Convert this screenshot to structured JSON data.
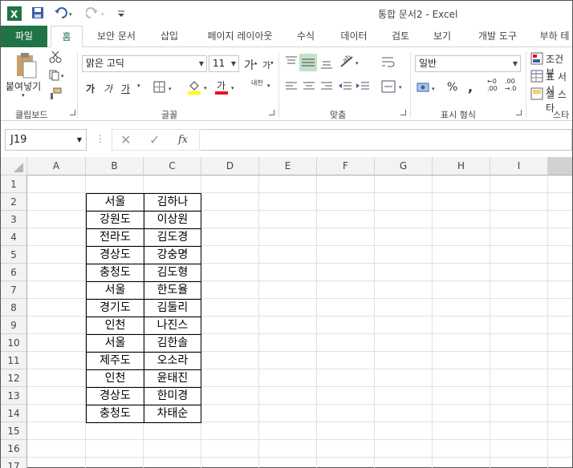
{
  "window": {
    "title": "통합 문서2 - Excel"
  },
  "quick_access": {
    "save": "저장",
    "undo": "실행 취소",
    "redo": "다시 실행"
  },
  "tabs": [
    "파일",
    "홈",
    "보안 문서",
    "삽입",
    "페이지 레이아웃",
    "수식",
    "데이터",
    "검토",
    "보기",
    "개발 도구",
    "부하 테"
  ],
  "ribbon": {
    "clipboard": {
      "paste_label": "붙여넣기",
      "group": "클립보드"
    },
    "font": {
      "name": "맑은 고딕",
      "size": "11",
      "bold": "가",
      "italic": "가",
      "underline": "가",
      "group": "글꼴",
      "grow": "가",
      "shrink": "가",
      "phonetic": "내천"
    },
    "alignment": {
      "group": "맞춤"
    },
    "number": {
      "format": "일반",
      "percent": "%",
      "comma": ",",
      "inc_decimal": ".00",
      "group": "표시 형식"
    },
    "styles": {
      "conditional": "조건부",
      "table": "표 서식",
      "cell": "셀 스타",
      "group": "스타"
    }
  },
  "formula_bar": {
    "name_box": "J19",
    "fx": "fx",
    "value": ""
  },
  "sheet": {
    "columns": [
      "A",
      "B",
      "C",
      "D",
      "E",
      "F",
      "G",
      "H",
      "I"
    ],
    "rows": [
      "1",
      "2",
      "3",
      "4",
      "5",
      "6",
      "7",
      "8",
      "9",
      "10",
      "11",
      "12",
      "13",
      "14",
      "15",
      "16",
      "17"
    ],
    "table": [
      [
        "서울",
        "김하나"
      ],
      [
        "강원도",
        "이상원"
      ],
      [
        "전라도",
        "김도경"
      ],
      [
        "경상도",
        "강숭명"
      ],
      [
        "충청도",
        "김도형"
      ],
      [
        "서울",
        "한도율"
      ],
      [
        "경기도",
        "김둘리"
      ],
      [
        "인천",
        "나진스"
      ],
      [
        "서울",
        "김한솔"
      ],
      [
        "제주도",
        "오소라"
      ],
      [
        "인천",
        "윤태진"
      ],
      [
        "경상도",
        "한미경"
      ],
      [
        "충청도",
        "차태순"
      ]
    ]
  },
  "colors": {
    "excel_green": "#217346",
    "fill_yellow": "#ffff00",
    "font_red": "#e81123"
  }
}
